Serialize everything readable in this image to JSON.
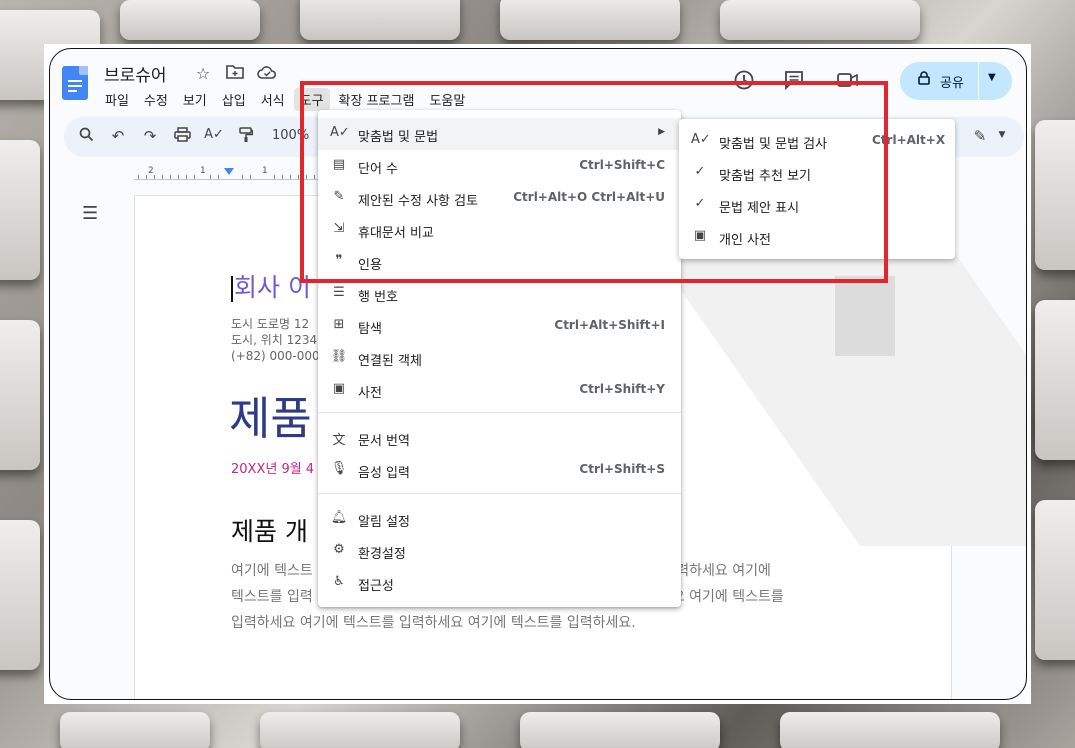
{
  "doc": {
    "title": "브로슈어",
    "menubar": [
      "파일",
      "수정",
      "보기",
      "삽입",
      "서식",
      "도구",
      "확장 프로그램",
      "도움말"
    ],
    "active_menu": "도구",
    "share_label": "공유",
    "zoom": "100%"
  },
  "icons": {
    "star": "star-icon",
    "move": "folder-move-icon",
    "cloud": "cloud-icon",
    "history": "history-icon",
    "comment": "comment-icon",
    "meet": "video-icon",
    "lock": "lock-icon",
    "search": "search-icon",
    "undo": "undo-icon",
    "redo": "redo-icon",
    "print": "print-icon",
    "spell": "spellcheck-icon",
    "paint": "paint-format-icon",
    "pen": "edit-icon"
  },
  "ruler": {
    "labels": [
      "2",
      "1",
      "1"
    ]
  },
  "page": {
    "company": "회사 이",
    "address_line1": "도시 도로명 12",
    "address_line2": "도시, 위치 1234",
    "phone": "(+82) 000-0000",
    "big_title": "제품",
    "date": "20XX년 9월 4",
    "heading": "제품 개",
    "para_line1": "여기에 텍스트                                                                        트를 입력하세요 여기에",
    "para_line2": "텍스트를 입력                                                                        력하세요 여기에 텍스트를",
    "para_line3": "입력하세요 여기에 텍스트를 입력하세요 여기에 텍스트를 입력하세요."
  },
  "tools_menu": {
    "items": [
      {
        "label": "맞춤법 및 문법",
        "shortcut": "",
        "icon": "spellcheck-icon"
      },
      {
        "label": "단어 수",
        "shortcut": "Ctrl+Shift+C",
        "icon": "word-count-icon"
      },
      {
        "label": "제안된 수정 사항 검토",
        "shortcut": "Ctrl+Alt+O Ctrl+Alt+U",
        "icon": "review-edits-icon"
      },
      {
        "label": "휴대문서 비교",
        "shortcut": "",
        "icon": "compare-icon"
      },
      {
        "label": "인용",
        "shortcut": "",
        "icon": "quote-icon"
      },
      {
        "label": "행 번호",
        "shortcut": "",
        "icon": "line-numbers-icon"
      },
      {
        "label": "탐색",
        "shortcut": "Ctrl+Alt+Shift+I",
        "icon": "explore-icon"
      },
      {
        "label": "연결된 객체",
        "shortcut": "",
        "icon": "linked-objects-icon"
      },
      {
        "label": "사전",
        "shortcut": "Ctrl+Shift+Y",
        "icon": "dictionary-icon"
      },
      {
        "label": "문서 번역",
        "shortcut": "",
        "icon": "translate-icon"
      },
      {
        "label": "음성 입력",
        "shortcut": "Ctrl+Shift+S",
        "icon": "mic-icon"
      },
      {
        "label": "알림 설정",
        "shortcut": "",
        "icon": "bell-icon"
      },
      {
        "label": "환경설정",
        "shortcut": "",
        "icon": "preferences-icon"
      },
      {
        "label": "접근성",
        "shortcut": "",
        "icon": "accessibility-icon"
      }
    ]
  },
  "spelling_submenu": {
    "items": [
      {
        "label": "맞춤법 및 문법 검사",
        "shortcut": "Ctrl+Alt+X"
      },
      {
        "label": "맞춤법 추천 보기",
        "shortcut": ""
      },
      {
        "label": "문법 제안 표시",
        "shortcut": ""
      },
      {
        "label": "개인 사전",
        "shortcut": ""
      }
    ]
  },
  "colors": {
    "highlight_box": "#e1262e",
    "share_bg": "#c2e7ff",
    "title_accent": "#2e3a87",
    "date_accent": "#c2258a"
  }
}
